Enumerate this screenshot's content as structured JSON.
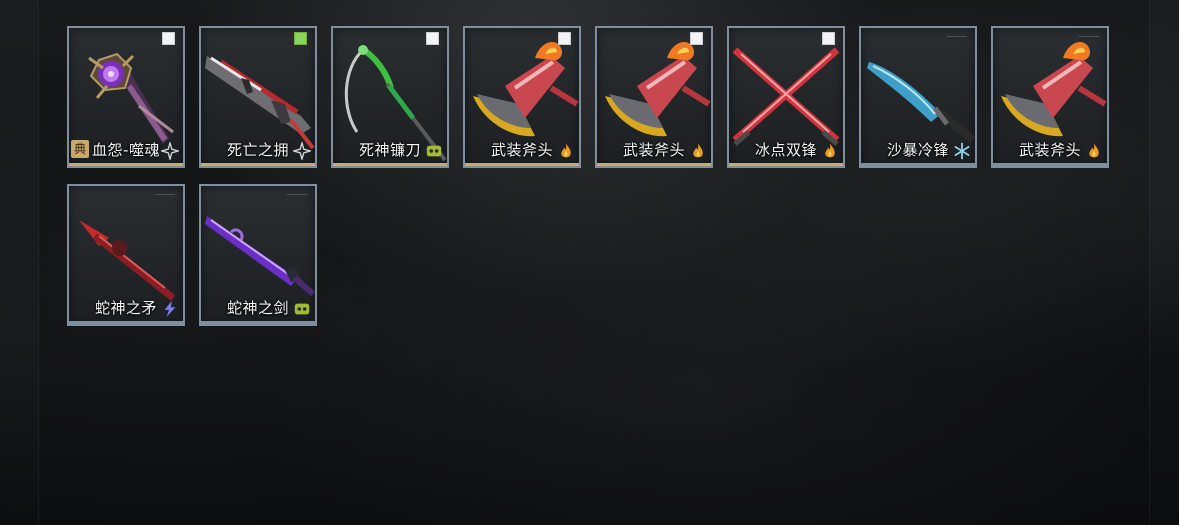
{
  "inventory": {
    "items": [
      {
        "name": "血怨-噬魂",
        "checked": false,
        "show_check": true,
        "element": "star-icon",
        "badge": "典",
        "weapon": "staff-icon",
        "bar_color": "#c7a86e"
      },
      {
        "name": "死亡之拥",
        "checked": true,
        "show_check": true,
        "element": "star-icon",
        "badge": "",
        "weapon": "rifle-icon",
        "bar_color": "#c7a86e"
      },
      {
        "name": "死神镰刀",
        "checked": false,
        "show_check": true,
        "element": "poison-icon",
        "badge": "",
        "weapon": "scythe-icon",
        "bar_color": "#c7a86e"
      },
      {
        "name": "武装斧头",
        "checked": false,
        "show_check": true,
        "element": "fire-icon",
        "badge": "",
        "weapon": "axe-icon",
        "bar_color": "#c7a86e"
      },
      {
        "name": "武装斧头",
        "checked": false,
        "show_check": true,
        "element": "fire-icon",
        "badge": "",
        "weapon": "axe-icon",
        "bar_color": "#c7a86e"
      },
      {
        "name": "冰点双锋",
        "checked": false,
        "show_check": true,
        "element": "fire-icon",
        "badge": "",
        "weapon": "dual-blades-icon",
        "bar_color": "#c7a86e"
      },
      {
        "name": "沙暴冷锋",
        "checked": false,
        "show_check": false,
        "element": "ice-icon",
        "badge": "",
        "weapon": "knife-icon",
        "bar_color": "#7f8f9f"
      },
      {
        "name": "武装斧头",
        "checked": false,
        "show_check": false,
        "element": "fire-icon",
        "badge": "",
        "weapon": "axe-icon",
        "bar_color": "#7f8f9f"
      },
      {
        "name": "蛇神之矛",
        "checked": false,
        "show_check": false,
        "element": "lightning-icon",
        "badge": "",
        "weapon": "spear-icon",
        "bar_color": "#7f8f9f"
      },
      {
        "name": "蛇神之剑",
        "checked": false,
        "show_check": false,
        "element": "poison-icon",
        "badge": "",
        "weapon": "sword-icon",
        "bar_color": "#7f8f9f"
      }
    ]
  },
  "colors": {
    "card_border": "#7f8f9f",
    "check_on": "#8ad35f",
    "rare_bar": "#c7a86e"
  }
}
